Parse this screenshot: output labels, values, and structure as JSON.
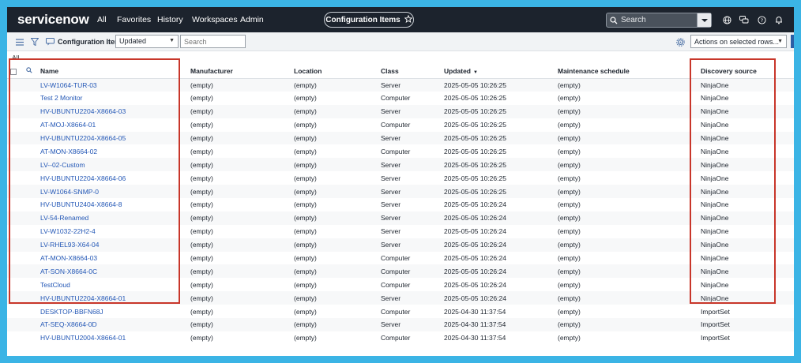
{
  "app": {
    "logo": "servicenow",
    "nav": [
      "All",
      "Favorites",
      "History",
      "Workspaces",
      "Admin"
    ],
    "title_pill": "Configuration Items",
    "search_placeholder": "Search"
  },
  "toolbar": {
    "list_title": "Configuration Items",
    "sort_field": "Updated",
    "search_placeholder": "Search",
    "actions_label": "Actions on selected rows..."
  },
  "breadcrumb": "All",
  "table": {
    "columns": [
      "Name",
      "Manufacturer",
      "Location",
      "Class",
      "Updated",
      "Maintenance schedule",
      "Discovery source"
    ],
    "rows": [
      [
        "LV-W1064-TUR-03",
        "(empty)",
        "(empty)",
        "Server",
        "2025-05-05 10:26:25",
        "(empty)",
        "NinjaOne"
      ],
      [
        "Test 2 Monitor",
        "(empty)",
        "(empty)",
        "Computer",
        "2025-05-05 10:26:25",
        "(empty)",
        "NinjaOne"
      ],
      [
        "HV-UBUNTU2204-X8664-03",
        "(empty)",
        "(empty)",
        "Server",
        "2025-05-05 10:26:25",
        "(empty)",
        "NinjaOne"
      ],
      [
        "AT-MOJ-X8664-01",
        "(empty)",
        "(empty)",
        "Computer",
        "2025-05-05 10:26:25",
        "(empty)",
        "NinjaOne"
      ],
      [
        "HV-UBUNTU2204-X8664-05",
        "(empty)",
        "(empty)",
        "Server",
        "2025-05-05 10:26:25",
        "(empty)",
        "NinjaOne"
      ],
      [
        "AT-MON-X8664-02",
        "(empty)",
        "(empty)",
        "Computer",
        "2025-05-05 10:26:25",
        "(empty)",
        "NinjaOne"
      ],
      [
        "LV--02-Custom",
        "(empty)",
        "(empty)",
        "Server",
        "2025-05-05 10:26:25",
        "(empty)",
        "NinjaOne"
      ],
      [
        "HV-UBUNTU2204-X8664-06",
        "(empty)",
        "(empty)",
        "Server",
        "2025-05-05 10:26:25",
        "(empty)",
        "NinjaOne"
      ],
      [
        "LV-W1064-SNMP-0",
        "(empty)",
        "(empty)",
        "Server",
        "2025-05-05 10:26:25",
        "(empty)",
        "NinjaOne"
      ],
      [
        "HV-UBUNTU2404-X8664-8",
        "(empty)",
        "(empty)",
        "Server",
        "2025-05-05 10:26:24",
        "(empty)",
        "NinjaOne"
      ],
      [
        "LV-54-Renamed",
        "(empty)",
        "(empty)",
        "Server",
        "2025-05-05 10:26:24",
        "(empty)",
        "NinjaOne"
      ],
      [
        "LV-W1032-22H2-4",
        "(empty)",
        "(empty)",
        "Server",
        "2025-05-05 10:26:24",
        "(empty)",
        "NinjaOne"
      ],
      [
        "LV-RHEL93-X64-04",
        "(empty)",
        "(empty)",
        "Server",
        "2025-05-05 10:26:24",
        "(empty)",
        "NinjaOne"
      ],
      [
        "AT-MON-X8664-03",
        "(empty)",
        "(empty)",
        "Computer",
        "2025-05-05 10:26:24",
        "(empty)",
        "NinjaOne"
      ],
      [
        "AT-SON-X8664-0C",
        "(empty)",
        "(empty)",
        "Computer",
        "2025-05-05 10:26:24",
        "(empty)",
        "NinjaOne"
      ],
      [
        "TestCloud",
        "(empty)",
        "(empty)",
        "Computer",
        "2025-05-05 10:26:24",
        "(empty)",
        "NinjaOne"
      ],
      [
        "HV-UBUNTU2204-X8664-01",
        "(empty)",
        "(empty)",
        "Server",
        "2025-05-05 10:26:24",
        "(empty)",
        "NinjaOne"
      ],
      [
        "DESKTOP-BBFN68J",
        "(empty)",
        "(empty)",
        "Computer",
        "2025-04-30 11:37:54",
        "(empty)",
        "ImportSet"
      ],
      [
        "AT-SEQ-X8664-0D",
        "(empty)",
        "(empty)",
        "Server",
        "2025-04-30 11:37:54",
        "(empty)",
        "ImportSet"
      ],
      [
        "HV-UBUNTU2004-X8664-01",
        "(empty)",
        "(empty)",
        "Computer",
        "2025-04-30 11:37:54",
        "(empty)",
        "ImportSet"
      ]
    ]
  },
  "colors": {
    "nav_bg": "#1c232d",
    "link": "#2357b6",
    "highlight": "#c8362a",
    "outer_border": "#3bb4e5"
  },
  "icons": [
    "hamburger-icon",
    "filter-icon",
    "chat-icon",
    "star-icon",
    "search-icon",
    "globe-icon",
    "chat-bubbles-icon",
    "help-icon",
    "bell-icon",
    "gear-icon",
    "list-search-icon"
  ]
}
